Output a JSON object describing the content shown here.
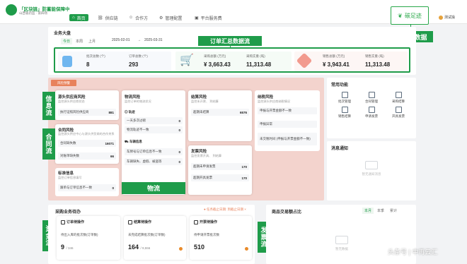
{
  "topbar": {
    "brand": "「区块链」防蓄能保障中",
    "brand_sub": "山西省药监  · 第四场",
    "nav": [
      {
        "label": "首页",
        "icon": "home-icon",
        "active": true
      },
      {
        "label": "供应链",
        "icon": "chain-icon",
        "active": false
      },
      {
        "label": "合作方",
        "icon": "partner-icon",
        "active": false
      },
      {
        "label": "管理配置",
        "icon": "settings-icon",
        "active": false
      },
      {
        "label": "平台服务费",
        "icon": "service-icon",
        "active": false
      }
    ],
    "carbon_button": "碳足迹",
    "carbon_label": "碳减排数据",
    "user": "测试操"
  },
  "business": {
    "title": "业务大盘",
    "tabs": [
      "今日",
      "本周",
      "上月"
    ],
    "date_from": "2025-02-01",
    "date_sep": "→",
    "date_to": "2025-03-31",
    "summary_label": "订单汇总数据流",
    "stats": [
      {
        "k1": "批次总数",
        "u1": "(个)",
        "v1": "8",
        "k2": "订单总数",
        "u2": "(个)",
        "v2": "293"
      },
      {
        "k1": "采购总额",
        "u1": "(万元)",
        "v1": "¥ 3,663.43",
        "k2": "采购实重",
        "u2": "(吨)",
        "v2": "11,313.48"
      },
      {
        "k1": "销售总额",
        "u1": "(万元)",
        "v1": "¥ 3,943.41",
        "k2": "销售实重",
        "u2": "(吨)",
        "v2": "11,313.48"
      }
    ]
  },
  "risk": {
    "button": "风险预警",
    "labels": {
      "info": "信息流",
      "contract": "合同流",
      "logistics": "物流",
      "capital": "资金流",
      "invoice": "发票流"
    },
    "source": {
      "title": "源头供应商风险",
      "sub": "监控源头供应商状态",
      "row_label": "执行证照风险供应商",
      "row_value": "881"
    },
    "contract": {
      "title": "合同风险",
      "sub": "监控源头供应中心与源头供货商的合作关系",
      "rows": [
        {
          "label": "合同缺失数",
          "value": "16071"
        },
        {
          "label": "对账单缺失数",
          "value": "66"
        }
      ]
    },
    "standard": {
      "title": "标准信息",
      "sub": "监控订单信息填写",
      "row_label": "跟单与订单信息不一致",
      "row_value": "0"
    },
    "logistics": {
      "title": "物流风险",
      "sub": "监控订单的物流状况",
      "groups": [
        {
          "name": "轨迹",
          "rows": [
            {
              "label": "一天多次过磅",
              "value": "0"
            },
            {
              "label": "物流轨迹不一致",
              "value": "0"
            }
          ]
        },
        {
          "name": "车辆信息",
          "rows": [
            {
              "label": "车牌号与订单信息不一致",
              "value": "0"
            },
            {
              "label": "车辆缺失、虚假、被盗等",
              "value": "0"
            }
          ]
        }
      ]
    },
    "settlement": {
      "title": "结算风险",
      "sub": "监控未开票、 到结算",
      "row_label": "超期未结算",
      "row_value": "6576"
    },
    "invoice": {
      "title": "发票风险",
      "sub": "监控发票开具、 到结算",
      "rows": [
        {
          "label": "超期未申请发票",
          "value": "170"
        },
        {
          "label": "超期开具发票",
          "value": "170"
        }
      ]
    },
    "tax": {
      "title": "纳税风险",
      "sub": "监控源头供应商纳税情况",
      "rows": [
        "申报与开票金额不一致",
        "申报异常",
        "未交税时间 (申报与开票金额不一致)"
      ]
    }
  },
  "common": {
    "title": "常用功能",
    "items": [
      {
        "label": "批次管理",
        "icon": "batch-icon"
      },
      {
        "label": "合同管理",
        "icon": "contract-icon"
      },
      {
        "label": "采购结算",
        "icon": "purchase-icon"
      },
      {
        "label": "销售结算",
        "icon": "sales-icon"
      },
      {
        "label": "申请发票",
        "icon": "invoice-apply-icon"
      },
      {
        "label": "开具发票",
        "icon": "invoice-issue-icon"
      }
    ]
  },
  "message": {
    "title": "消息通知",
    "empty": "暂无通知消息"
  },
  "todo": {
    "title": "采购业务待办",
    "notice": "● 任务截止日期: 到截止日期 ×",
    "cards": [
      {
        "title": "订单待操作",
        "desc": "待出入库的批次数(订单数)",
        "value": "9",
        "total": "/ 346"
      },
      {
        "title": "结算待操作",
        "desc": "未完成结算批次数(订单数)",
        "value": "164",
        "total": "/ 9,556"
      },
      {
        "title": "开票待操作",
        "desc": "待申请开票批次数",
        "value": "510",
        "total": ""
      }
    ]
  },
  "goods": {
    "title": "商品交易额占比",
    "tabs": [
      "本月",
      "本季",
      "累计"
    ],
    "empty": "暂无数据"
  },
  "watermark": "头条号 | 中再云汇"
}
